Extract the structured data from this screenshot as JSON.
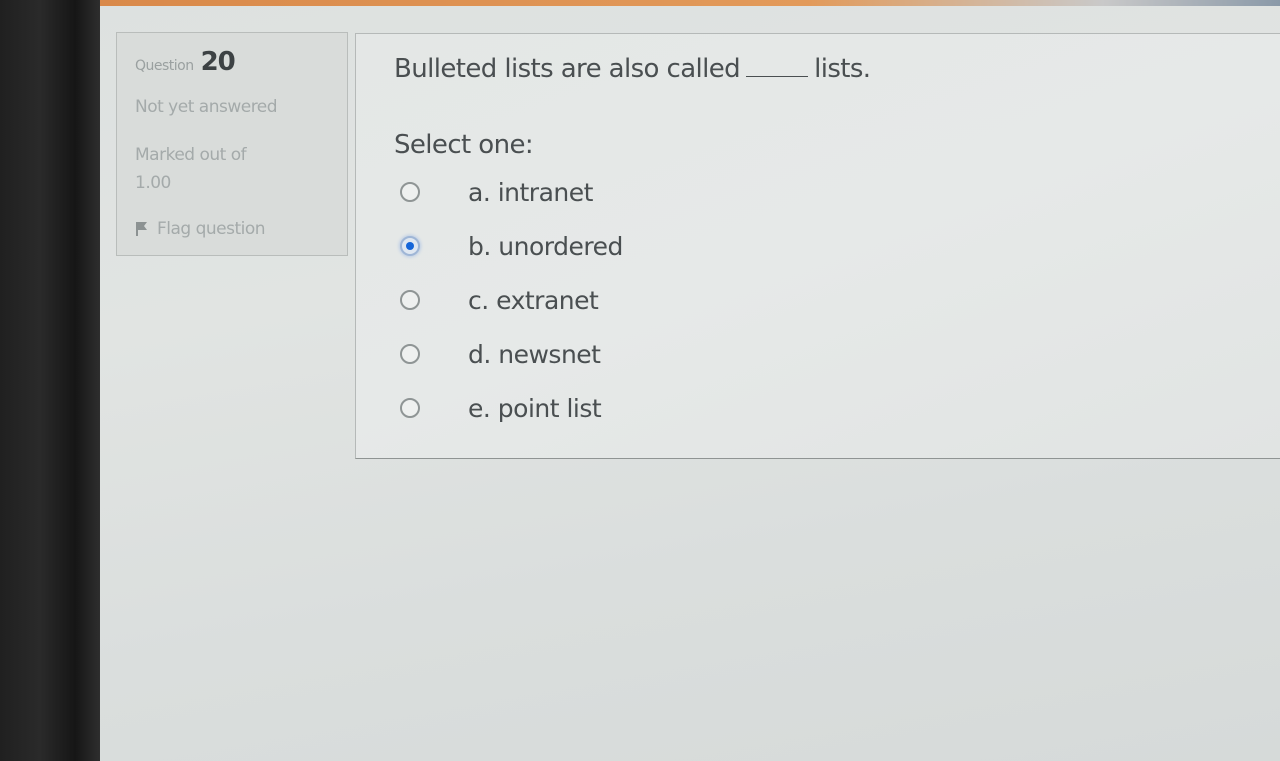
{
  "info": {
    "question_label": "Question",
    "question_number": "20",
    "state": "Not yet answered",
    "marked_line1": "Marked out of",
    "marked_line2": "1.00",
    "flag_label": "Flag question",
    "flag_icon": "flag-icon"
  },
  "question": {
    "text_before": "Bulleted lists are also called",
    "text_after": "lists.",
    "prompt": "Select one:",
    "options": [
      {
        "label": "a. intranet",
        "selected": false
      },
      {
        "label": "b. unordered",
        "selected": true
      },
      {
        "label": "c. extranet",
        "selected": false
      },
      {
        "label": "d. newsnet",
        "selected": false
      },
      {
        "label": "e. point list",
        "selected": false
      }
    ]
  },
  "colors": {
    "accent_top_bar": "#e29a5a",
    "radio_selected": "#1565d8"
  }
}
